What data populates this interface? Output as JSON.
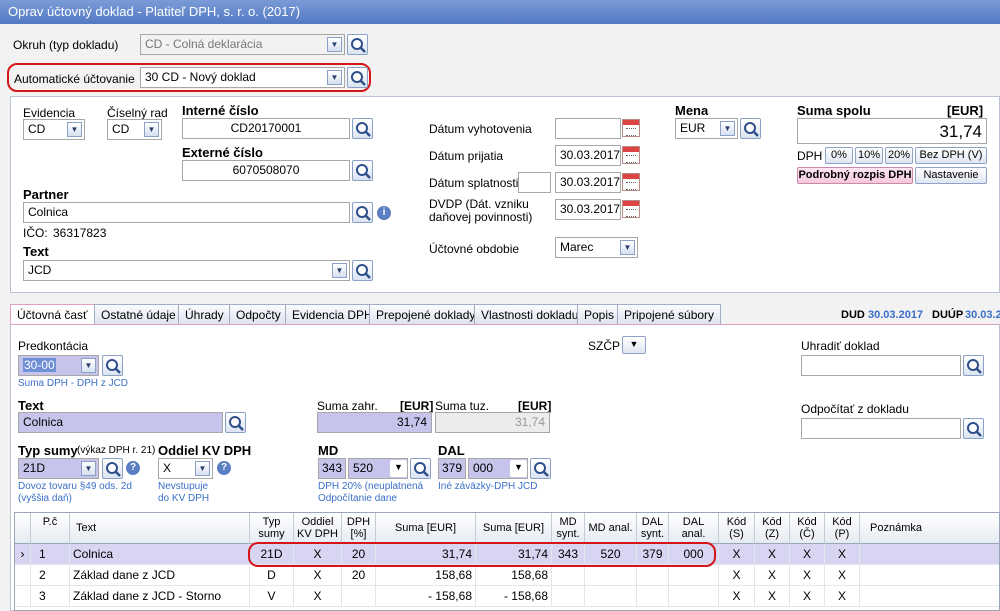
{
  "window": {
    "title": "Oprav účtovný doklad - Platiteľ DPH, s. r. o. (2017)"
  },
  "top": {
    "okruh_label": "Okruh (typ dokladu)",
    "okruh_value": "CD - Colná deklarácia",
    "auto_label": "Automatické účtovanie",
    "auto_value": "30 CD - Nový doklad"
  },
  "header": {
    "evidencia_label": "Evidencia",
    "evidencia_value": "CD",
    "rad_label": "Číselný rad",
    "rad_value": "CD",
    "interne_label": "Interné číslo",
    "interne_value": "CD20170001",
    "externe_label": "Externé číslo",
    "externe_value": "6070508070",
    "partner_label": "Partner",
    "partner_value": "Colnica",
    "ico_label": "IČO:",
    "ico_value": "36317823",
    "text_label": "Text",
    "text_value": "JCD",
    "dat_vyh_label": "Dátum vyhotovenia",
    "dat_vyh_value": "",
    "dat_prij_label": "Dátum prijatia",
    "dat_prij_value": "30.03.2017",
    "dat_spl_label": "Dátum splatnosti",
    "dat_spl_days": "",
    "dat_spl_value": "30.03.2017",
    "dvdp_label_1": "DVDP (Dát. vzniku",
    "dvdp_label_2": "daňovej povinnosti)",
    "dvdp_value": "30.03.2017",
    "obdobie_label": "Účtovné obdobie",
    "obdobie_value": "Marec",
    "mena_label": "Mena",
    "mena_value": "EUR",
    "suma_label": "Suma spolu",
    "suma_unit": "[EUR]",
    "suma_value": "31,74",
    "dph_label": "DPH",
    "btn_0": "0%",
    "btn_10": "10%",
    "btn_20": "20%",
    "btn_bez": "Bez DPH (V)",
    "btn_rozpis": "Podrobný rozpis DPH",
    "btn_nastavenie": "Nastavenie"
  },
  "tabs": [
    "Účtovná časť",
    "Ostatné údaje",
    "Úhrady",
    "Odpočty",
    "Evidencia DPH",
    "Prepojené doklady",
    "Vlastnosti dokladu",
    "Popis",
    "Pripojené súbory"
  ],
  "dud": {
    "dud_label": "DUD",
    "dud_value": "30.03.2017",
    "duup_label": "DUÚP",
    "duup_value": "30.03.2"
  },
  "detail": {
    "predkont_label": "Predkontácia",
    "predkont_value": "30-00",
    "predkont_note": "Suma DPH - DPH z JCD",
    "szcp_label": "SZČP",
    "uhradit_label": "Uhradiť doklad",
    "uhradit_value": "",
    "odpocitat_label": "Odpočítať z dokladu",
    "odpocitat_value": "",
    "text_label": "Text",
    "text_value": "Colnica",
    "suma_zahr_label": "Suma zahr.",
    "suma_zahr_unit": "[EUR]",
    "suma_zahr_value": "31,74",
    "suma_tuz_label": "Suma tuz.",
    "suma_tuz_unit": "[EUR]",
    "suma_tuz_value": "31,74",
    "typ_label": "Typ sumy",
    "typ_sub": "(výkaz DPH r. 21)",
    "typ_value": "21D",
    "typ_note_1": "Dovoz tovaru §49 ods. 2d",
    "typ_note_2": "(vyššia daň)",
    "oddiel_label": "Oddiel KV DPH",
    "oddiel_value": "X",
    "oddiel_note_1": "Nevstupuje",
    "oddiel_note_2": "do KV DPH",
    "md_label": "MD",
    "md_synt": "343",
    "md_anal": "520",
    "md_note_1": "DPH 20% (neuplatnená",
    "md_note_2": "Odpočítanie dane",
    "dal_label": "DAL",
    "dal_synt": "379",
    "dal_anal": "000",
    "dal_note": "Iné záväzky-DPH JCD"
  },
  "grid": {
    "headers": [
      [
        "P.č"
      ],
      [
        "Text"
      ],
      [
        "Typ",
        "sumy"
      ],
      [
        "Oddiel",
        "KV DPH"
      ],
      [
        "DPH",
        "[%]"
      ],
      [
        "Suma [EUR]"
      ],
      [
        "Suma [EUR]"
      ],
      [
        "MD",
        "synt."
      ],
      [
        "MD anal."
      ],
      [
        "DAL",
        "synt."
      ],
      [
        "DAL",
        "anal."
      ],
      [
        "Kód",
        "(S)"
      ],
      [
        "Kód",
        "(Z)"
      ],
      [
        "Kód",
        "(Č)"
      ],
      [
        "Kód",
        "(P)"
      ],
      [
        "Poznámka"
      ]
    ],
    "rows": [
      [
        "1",
        "Colnica",
        "21D",
        "X",
        "20",
        "31,74",
        "31,74",
        "343",
        "520",
        "379",
        "000",
        "X",
        "X",
        "X",
        "X",
        ""
      ],
      [
        "2",
        "Základ dane z JCD",
        "D",
        "X",
        "20",
        "158,68",
        "158,68",
        "",
        "",
        "",
        "",
        "X",
        "X",
        "X",
        "X",
        ""
      ],
      [
        "3",
        "Základ dane z JCD - Storno",
        "V",
        "X",
        "",
        "- 158,68",
        "- 158,68",
        "",
        "",
        "",
        "",
        "X",
        "X",
        "X",
        "X",
        ""
      ]
    ]
  },
  "colors": {
    "highlight": "#d4161b",
    "accent": "#3b6fc8"
  }
}
